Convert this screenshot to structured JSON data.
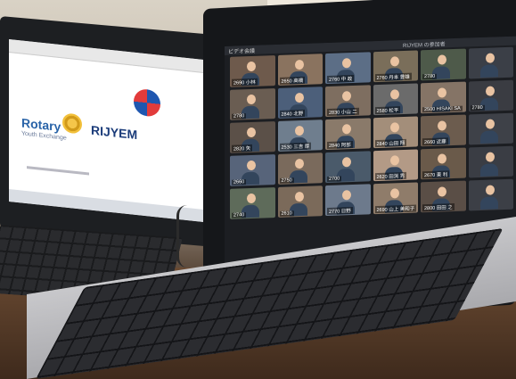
{
  "left_laptop": {
    "logo_text": "Rotary",
    "program_name": "RIJYEM",
    "subtitle": "Youth Exchange"
  },
  "zoom": {
    "window_title": "ビデオ会議",
    "meeting_title": "RIJYEM の参加者",
    "participants": [
      {
        "label": "2690 小林",
        "bg": "#6e5a4c"
      },
      {
        "label": "2650 高橋",
        "bg": "#8a735f"
      },
      {
        "label": "2760 中 政",
        "bg": "#5c6e86"
      },
      {
        "label": "2760 丹本 豊雄",
        "bg": "#7a6e5a"
      },
      {
        "label": "2780",
        "bg": "#4e5a4a"
      },
      {
        "label": "",
        "bg": "#3b3f47"
      },
      {
        "label": "2780",
        "bg": "#6a5d52"
      },
      {
        "label": "2840 北野",
        "bg": "#4c5f7a"
      },
      {
        "label": "2830 小山 二",
        "bg": "#7e6e60"
      },
      {
        "label": "2580 松平",
        "bg": "#6b6b6b"
      },
      {
        "label": "2500 HISAKI SA",
        "bg": "#857466"
      },
      {
        "label": "2780",
        "bg": "#3a3c42"
      },
      {
        "label": "2820 矢",
        "bg": "#5b5048"
      },
      {
        "label": "2530 三吉 厚",
        "bg": "#6f7e8e"
      },
      {
        "label": "2840 阿部",
        "bg": "#8a7a6a"
      },
      {
        "label": "2840 山田 翔",
        "bg": "#a38e7a"
      },
      {
        "label": "2660 近藤",
        "bg": "#6c5c4e"
      },
      {
        "label": "",
        "bg": "#3e4148"
      },
      {
        "label": "2660",
        "bg": "#57647a"
      },
      {
        "label": "2750",
        "bg": "#7a6a5c"
      },
      {
        "label": "2700",
        "bg": "#4a5a6a"
      },
      {
        "label": "2620 田渕 秀",
        "bg": "#b39a86"
      },
      {
        "label": "2670 東 利",
        "bg": "#6a5a4a"
      },
      {
        "label": "",
        "bg": "#3a3d44"
      },
      {
        "label": "2740",
        "bg": "#5e6b5a"
      },
      {
        "label": "2610",
        "bg": "#7b6a5a"
      },
      {
        "label": "2770 日野",
        "bg": "#6d7a8c"
      },
      {
        "label": "2690 山上 美和子",
        "bg": "#8f7c6a"
      },
      {
        "label": "2800 田田 之",
        "bg": "#5a4e46"
      },
      {
        "label": "",
        "bg": "#3c3f46"
      }
    ]
  },
  "taskbar_icons": [
    "#3b82f6",
    "#f5c542",
    "#e04848",
    "#4ac36a",
    "#9a5ae0",
    "#f08a2a",
    "#4aa8e0",
    "#dcdcdc"
  ]
}
